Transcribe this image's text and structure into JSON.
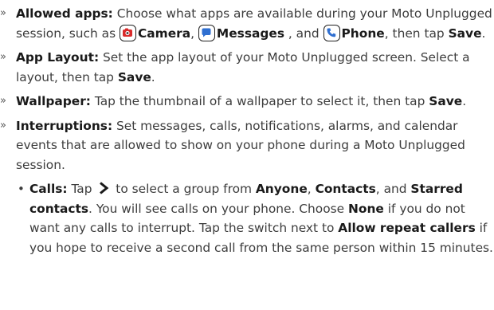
{
  "items": [
    {
      "marker": "»",
      "title": "Allowed apps:",
      "t1": " Choose what apps are available during your Moto Unplugged session, such as ",
      "app1": "Camera",
      "sep1": ", ",
      "app2": "Messages",
      "sep2": " , and ",
      "app3": "Phone",
      "t2": ", then tap ",
      "save": "Save",
      "end": "."
    },
    {
      "marker": "»",
      "title": "App Layout:",
      "t1": " Set the app layout of your Moto Unplugged screen. Select a layout, then tap ",
      "save": "Save",
      "end": "."
    },
    {
      "marker": "»",
      "title": "Wallpaper:",
      "t1": " Tap the thumbnail of a wallpaper to select it, then tap ",
      "save": "Save",
      "end": "."
    },
    {
      "marker": "»",
      "title": "Interruptions:",
      "t1": " Set messages, calls, notifications, alarms, and calendar events that are allowed to show on your phone during a Moto Unplugged session."
    }
  ],
  "sub": {
    "dot": "•",
    "title": "Calls:",
    "t1": " Tap ",
    "t2": " to select a group from ",
    "opt1": "Anyone",
    "c1": ", ",
    "opt2": "Contacts",
    "c2": ", and ",
    "opt3": "Starred contacts",
    "t3": ". You will see calls on your phone. Choose ",
    "none": "None",
    "t4": " if you do not want any calls to interrupt. Tap the switch next to ",
    "repeat": "Allow repeat callers",
    "t5": " if you hope to receive a second call from the same person within 15 minutes."
  },
  "icons": {
    "camera": "camera-icon",
    "messages": "messages-icon",
    "phone": "phone-icon",
    "chevron": "chevron-right-icon"
  },
  "colors": {
    "camera_accent": "#d92b2b",
    "messages_accent": "#2f6fd1",
    "phone_accent": "#2f6fd1"
  }
}
